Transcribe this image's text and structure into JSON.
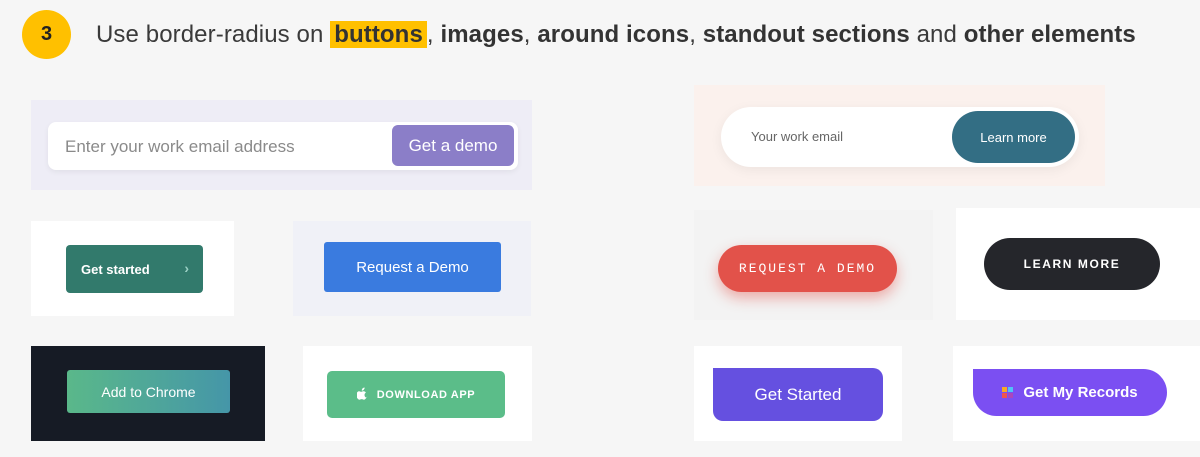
{
  "header": {
    "step_number": "3",
    "intro": "Use border-radius on ",
    "highlight": "buttons",
    "sep1": ", ",
    "item2": "images",
    "sep2": ", ",
    "item3": "around icons",
    "sep3": ", ",
    "item4": "standout sections",
    "connector": " and ",
    "item5": "other elements"
  },
  "examples": {
    "email_demo": {
      "placeholder": "Enter your work email address",
      "button": "Get a demo"
    },
    "pill_email": {
      "placeholder": "Your work email",
      "button": "Learn more"
    },
    "get_started_green": {
      "label": "Get started",
      "chevron": "›"
    },
    "request_demo_blue": {
      "label": "Request a Demo"
    },
    "request_demo_red": {
      "label": "REQUEST A DEMO"
    },
    "learn_more_dark": {
      "label": "LEARN MORE"
    },
    "add_to_chrome": {
      "label": "Add to Chrome"
    },
    "download_app": {
      "label": "DOWNLOAD APP",
      "icon": "apple-icon"
    },
    "get_started_purple": {
      "label": "Get Started"
    },
    "get_my_records": {
      "label": "Get My Records",
      "icon": "colorful-dots-icon"
    }
  },
  "colors": {
    "highlight": "#ffc000",
    "get_a_demo": "#8b7ec8",
    "learn_more_teal": "#336e84",
    "get_started_green": "#327a6c",
    "request_demo_blue": "#3a7bdf",
    "request_demo_red": "#e2524a",
    "learn_more_dark": "#25262b",
    "download_app_green": "#5bbd89",
    "get_started_purple": "#6550e0",
    "get_my_records_purple": "#7b4ff2"
  }
}
